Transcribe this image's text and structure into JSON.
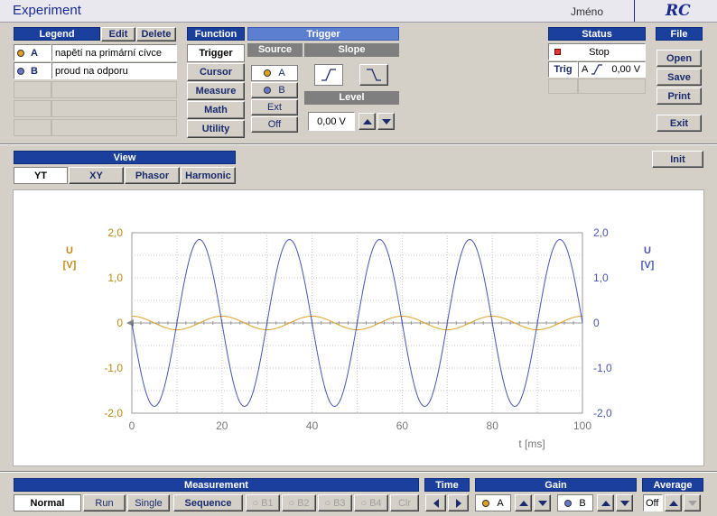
{
  "title": "Experiment",
  "user_name": "Jméno",
  "brand": "RC",
  "legend": {
    "header": "Legend",
    "edit": "Edit",
    "delete": "Delete",
    "rows": [
      {
        "key": "A",
        "label": "napětí na primární cívce",
        "color": "#e0a020"
      },
      {
        "key": "B",
        "label": "proud na odporu",
        "color": "#6677cc"
      }
    ]
  },
  "function": {
    "header": "Function",
    "items": [
      "Trigger",
      "Cursor",
      "Measure",
      "Math",
      "Utility"
    ],
    "selected": "Trigger"
  },
  "trigger": {
    "header": "Trigger",
    "source_header": "Source",
    "slope_header": "Slope",
    "level_header": "Level",
    "source": [
      "A",
      "B",
      "Ext",
      "Off"
    ],
    "level_value": "0,00 V"
  },
  "status": {
    "header": "Status",
    "state": "Stop",
    "trig_label": "Trig",
    "trig_channel": "A",
    "trig_value": "0,00 V"
  },
  "file": {
    "header": "File",
    "open": "Open",
    "save": "Save",
    "print": "Print",
    "exit": "Exit"
  },
  "view": {
    "header": "View",
    "tabs": [
      "YT",
      "XY",
      "Phasor",
      "Harmonic"
    ],
    "selected": "YT",
    "init": "Init"
  },
  "chart_data": {
    "type": "line",
    "xlabel": "t [ms]",
    "ylabel_left": "U\n[V]",
    "ylabel_right": "U\n[V]",
    "xlim": [
      0,
      100
    ],
    "ylim": [
      -2,
      2
    ],
    "x_ticks": [
      "0",
      "20",
      "40",
      "60",
      "80",
      "100"
    ],
    "y_ticks": [
      "2,0",
      "1,0",
      "0",
      "-1,0",
      "-2,0"
    ],
    "grid": true,
    "series": [
      {
        "name": "A",
        "color": "#e0a020",
        "amplitude": 0.15,
        "period_ms": 20,
        "phase_deg": 90
      },
      {
        "name": "B",
        "color": "#4a55b0",
        "amplitude": 1.85,
        "period_ms": 20,
        "phase_deg": 180
      }
    ]
  },
  "bottom": {
    "measurement": {
      "header": "Measurement",
      "buttons": [
        "Normal",
        "Run",
        "Single",
        "Sequence"
      ],
      "selected": "Normal",
      "bufs": [
        "B1",
        "B2",
        "B3",
        "B4"
      ],
      "clr": "Clr"
    },
    "time": {
      "header": "Time"
    },
    "gain": {
      "header": "Gain",
      "a": "A",
      "b": "B"
    },
    "average": {
      "header": "Average",
      "value": "Off"
    }
  }
}
